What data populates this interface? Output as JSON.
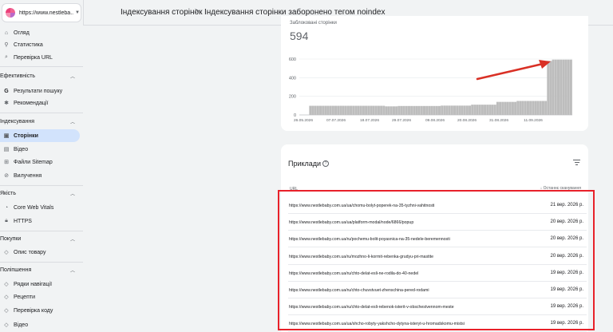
{
  "property": {
    "name": "https://www.nestleba..."
  },
  "sidebar": {
    "top_items": [
      {
        "label": "Огляд",
        "icon": "home-icon"
      },
      {
        "label": "Статистика",
        "icon": "compass-icon"
      },
      {
        "label": "Перевірка URL",
        "icon": "search-icon"
      }
    ],
    "sections": [
      {
        "title": "Ефективність",
        "items": [
          {
            "label": "Результати пошуку",
            "icon": "google-icon"
          },
          {
            "label": "Рекомендації",
            "icon": "sparkle-icon"
          }
        ]
      },
      {
        "title": "Індексування",
        "items": [
          {
            "label": "Сторінки",
            "icon": "pages-icon"
          },
          {
            "label": "Відео",
            "icon": "video-icon"
          },
          {
            "label": "Файли Sitemap",
            "icon": "sitemap-icon"
          },
          {
            "label": "Вилучення",
            "icon": "removal-icon"
          }
        ]
      },
      {
        "title": "Якість",
        "items": [
          {
            "label": "Core Web Vitals",
            "icon": "gauge-icon"
          },
          {
            "label": "HTTPS",
            "icon": "lock-icon"
          }
        ]
      },
      {
        "title": "Покупки",
        "items": [
          {
            "label": "Опис товару",
            "icon": "tag-icon"
          }
        ]
      },
      {
        "title": "Поліпшення",
        "items": [
          {
            "label": "Рядки навігації",
            "icon": "layers-icon"
          },
          {
            "label": "Рецепти",
            "icon": "layers-icon"
          },
          {
            "label": "Перевірка коду",
            "icon": "layers-icon"
          },
          {
            "label": "Відео",
            "icon": "layers-icon"
          }
        ]
      }
    ]
  },
  "breadcrumb": {
    "parent": "Індексування сторінок",
    "separator": ">",
    "current": "Індексування сторінки заборонено тегом noindex"
  },
  "metric": {
    "label": "Заблоковані сторінки",
    "value": "594"
  },
  "chart_data": {
    "type": "bar",
    "x_tick_labels": [
      "26.05.2026",
      "07.07.2026",
      "18.07.2026",
      "29.07.2026",
      "09.08.2026",
      "20.08.2026",
      "31.08.2026",
      "11.09.2026"
    ],
    "ylim": [
      0,
      600
    ],
    "y_ticks": [
      0,
      200,
      400,
      600
    ],
    "grid": true,
    "bar_color": "#bdbdbd",
    "annotation": {
      "type": "arrow",
      "color": "#d93025"
    },
    "phases": [
      {
        "count": 2,
        "value": 0
      },
      {
        "count": 30,
        "value": 98
      },
      {
        "count": 5,
        "value": 92
      },
      {
        "count": 17,
        "value": 96
      },
      {
        "count": 12,
        "value": 100
      },
      {
        "count": 10,
        "value": 110
      },
      {
        "count": 8,
        "value": 140
      },
      {
        "count": 12,
        "value": 150
      },
      {
        "count": 2,
        "value": 580
      },
      {
        "count": 8,
        "value": 594
      }
    ]
  },
  "examples": {
    "title": "Приклади",
    "col_url": "URL",
    "col_date": "↓ Останнє сканування",
    "rows": [
      {
        "url": "https://www.nestlebaby.com.ua/ua/chomu-bolyt-poperek-na-35-tyzhni-vahitnosti",
        "date": "21 вер. 2026 р."
      },
      {
        "url": "https://www.nestlebaby.com.ua/ua/platform-modal/node/6866/popup",
        "date": "20 вер. 2026 р."
      },
      {
        "url": "https://www.nestlebaby.com.ua/ru/pochemu-bolit-poyasnica-na-35-nedele-beremennosti",
        "date": "20 вер. 2026 р."
      },
      {
        "url": "https://www.nestlebaby.com.ua/ru/mozhno-li-kormit-rebenka-grudyu-pri-mastite",
        "date": "20 вер. 2026 р."
      },
      {
        "url": "https://www.nestlebaby.com.ua/ru/chto-delat-esli-ne-rodila-do-40-nedel",
        "date": "19 вер. 2026 р."
      },
      {
        "url": "https://www.nestlebaby.com.ua/ru/chto-chuvstvuet-zhenschina-pered-rodami",
        "date": "19 вер. 2026 р."
      },
      {
        "url": "https://www.nestlebaby.com.ua/ru/chto-delat-esli-rebenok-isterit-v-obschestvennom-meste",
        "date": "19 вер. 2026 р."
      },
      {
        "url": "https://www.nestlebaby.com.ua/ua/shcho-robyty-yakshcho-dytyna-isteryt-u-hromadskomu-mistsi",
        "date": "19 вер. 2026 р."
      }
    ]
  }
}
